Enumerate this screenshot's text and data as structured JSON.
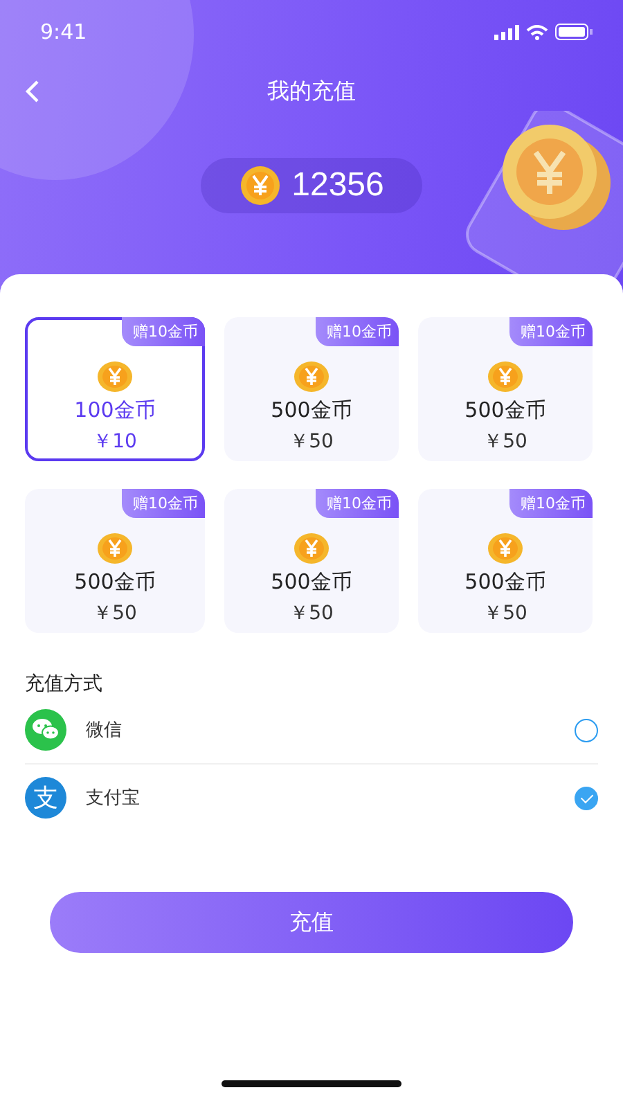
{
  "status_bar": {
    "time": "9:41"
  },
  "header": {
    "title": "我的充值"
  },
  "balance": {
    "amount": "12356"
  },
  "packages": [
    {
      "bonus": "赠10金币",
      "coins": "100金币",
      "price": "￥10",
      "selected": true
    },
    {
      "bonus": "赠10金币",
      "coins": "500金币",
      "price": "￥50",
      "selected": false
    },
    {
      "bonus": "赠10金币",
      "coins": "500金币",
      "price": "￥50",
      "selected": false
    },
    {
      "bonus": "赠10金币",
      "coins": "500金币",
      "price": "￥50",
      "selected": false
    },
    {
      "bonus": "赠10金币",
      "coins": "500金币",
      "price": "￥50",
      "selected": false
    },
    {
      "bonus": "赠10金币",
      "coins": "500金币",
      "price": "￥50",
      "selected": false
    }
  ],
  "payment": {
    "title": "充值方式",
    "methods": [
      {
        "kind": "wechat",
        "label": "微信",
        "selected": false
      },
      {
        "kind": "alipay",
        "icon_text": "支",
        "label": "支付宝",
        "selected": true
      }
    ]
  },
  "submit_button": "充值"
}
